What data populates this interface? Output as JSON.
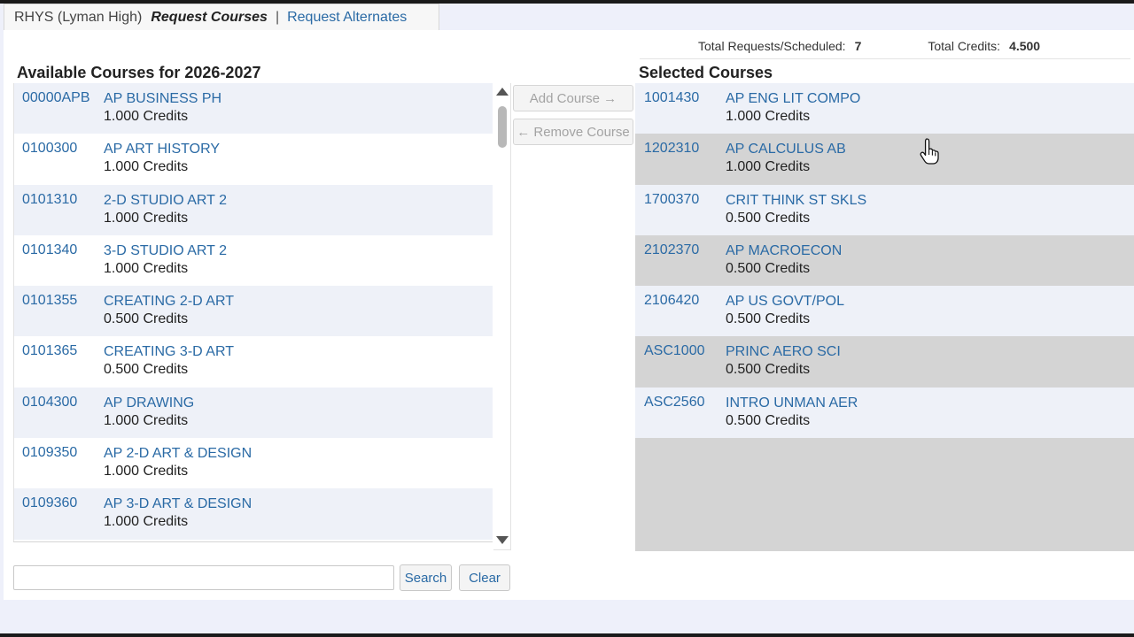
{
  "tabs": {
    "school": "RHYS (Lyman High)",
    "current": "Request Courses",
    "separator": "|",
    "alternates": "Request Alternates"
  },
  "totals": {
    "requests_label": "Total Requests/Scheduled:",
    "requests_value": "7",
    "credits_label": "Total Credits:",
    "credits_value": "4.500"
  },
  "available": {
    "title": "Available Courses for 2026-2027",
    "courses": [
      {
        "code": "00000APB",
        "name": "AP BUSINESS PH",
        "credits": "1.000 Credits"
      },
      {
        "code": "0100300",
        "name": "AP ART HISTORY",
        "credits": "1.000 Credits"
      },
      {
        "code": "0101310",
        "name": "2-D STUDIO ART 2",
        "credits": "1.000 Credits"
      },
      {
        "code": "0101340",
        "name": "3-D STUDIO ART 2",
        "credits": "1.000 Credits"
      },
      {
        "code": "0101355",
        "name": "CREATING 2-D ART",
        "credits": "0.500 Credits"
      },
      {
        "code": "0101365",
        "name": "CREATING 3-D ART",
        "credits": "0.500 Credits"
      },
      {
        "code": "0104300",
        "name": "AP DRAWING",
        "credits": "1.000 Credits"
      },
      {
        "code": "0109350",
        "name": "AP 2-D ART & DESIGN",
        "credits": "1.000 Credits"
      },
      {
        "code": "0109360",
        "name": "AP 3-D ART & DESIGN",
        "credits": "1.000 Credits"
      }
    ]
  },
  "actions": {
    "add_label": "Add Course →",
    "remove_label": "← Remove Course"
  },
  "selected": {
    "title": "Selected Courses",
    "courses": [
      {
        "code": "1001430",
        "name": "AP ENG LIT COMPO",
        "credits": "1.000 Credits"
      },
      {
        "code": "1202310",
        "name": "AP CALCULUS AB",
        "credits": "1.000 Credits"
      },
      {
        "code": "1700370",
        "name": "CRIT THINK ST SKLS",
        "credits": "0.500 Credits"
      },
      {
        "code": "2102370",
        "name": "AP MACROECON",
        "credits": "0.500 Credits"
      },
      {
        "code": "2106420",
        "name": "AP US GOVT/POL",
        "credits": "0.500 Credits"
      },
      {
        "code": "ASC1000",
        "name": "PRINC AERO SCI",
        "credits": "0.500 Credits"
      },
      {
        "code": "ASC2560",
        "name": "INTRO UNMAN AER",
        "credits": "0.500 Credits"
      }
    ]
  },
  "search": {
    "value": "",
    "button_label": "Search",
    "clear_label": "Clear"
  },
  "icons": {
    "scroll_up": "triangle-up",
    "scroll_down": "triangle-down",
    "cursor": "hand-pointer"
  },
  "colors": {
    "link": "#2a6aa5",
    "row_shade": "#eef1f8",
    "empty_area": "#d4d4d4",
    "page_bg": "#eef0fa"
  }
}
